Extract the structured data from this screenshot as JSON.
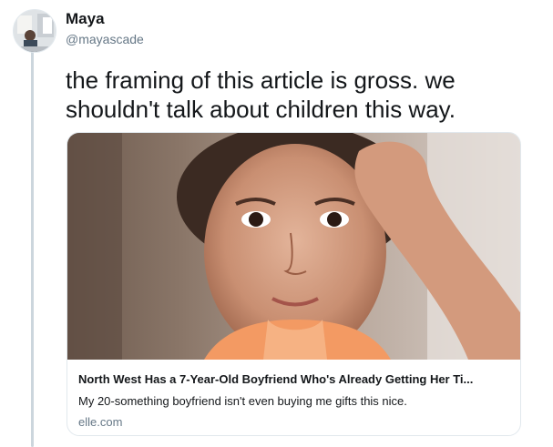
{
  "tweet": {
    "display_name": "Maya",
    "handle": "@mayascade",
    "text": "the framing of this article is gross. we shouldn't talk about children this way."
  },
  "card": {
    "title": "North West Has a 7-Year-Old Boyfriend Who's Already Getting Her Ti...",
    "description": "My 20-something boyfriend isn't even buying me gifts this nice.",
    "domain": "elle.com"
  },
  "colors": {
    "text_primary": "#14171a",
    "text_secondary": "#657786",
    "border": "#e1e8ed",
    "thread_line": "#ccd6dd"
  }
}
